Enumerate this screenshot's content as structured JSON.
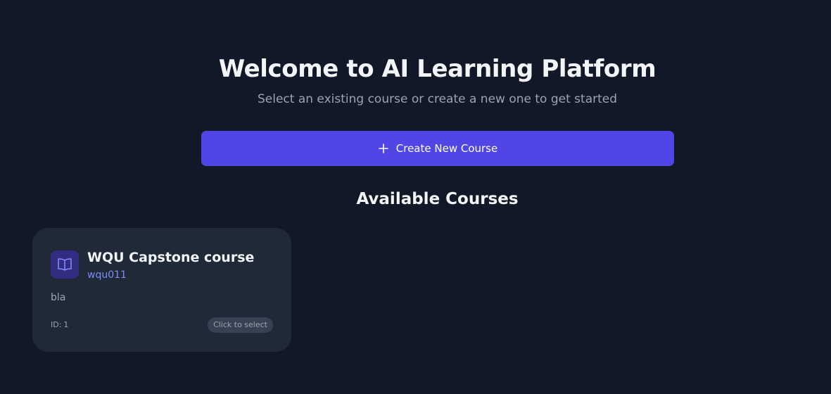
{
  "header": {
    "title": "Welcome to AI Learning Platform",
    "subtitle": "Select an existing course or create a new one to get started"
  },
  "actions": {
    "create_label": "Create New Course",
    "create_icon": "plus-icon"
  },
  "courses_section": {
    "title": "Available Courses",
    "courses": [
      {
        "name": "WQU Capstone course",
        "code": "wqu011",
        "description": "bla",
        "id_label": "ID:",
        "id": "1",
        "select_label": "Click to select",
        "icon": "book-icon"
      }
    ]
  },
  "colors": {
    "background": "#111827",
    "card": "#1f2937",
    "accent": "#4f46e5",
    "accent_text": "#818cf8",
    "icon_bg": "#312e81"
  }
}
